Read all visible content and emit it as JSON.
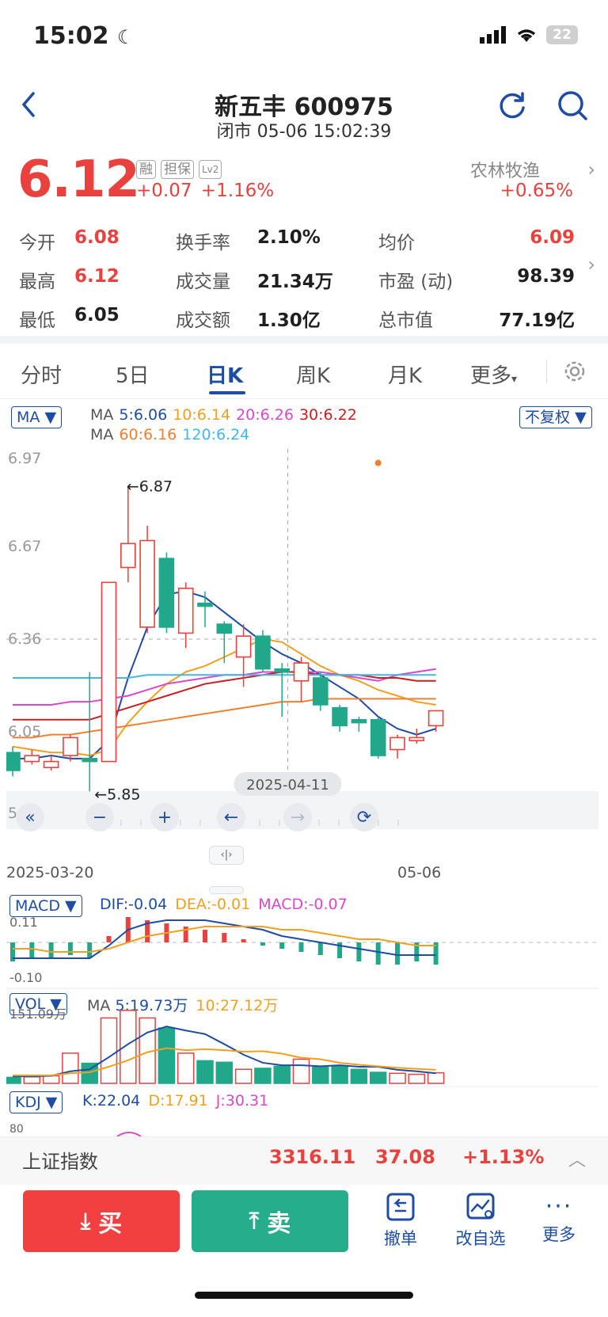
{
  "status_bar": {
    "time": "15:02",
    "battery": "22"
  },
  "header": {
    "title": "新五丰 600975",
    "subtitle": "闭市 05-06 15:02:39"
  },
  "quote": {
    "price": "6.12",
    "tags": [
      "融",
      "担保",
      "Lv2"
    ],
    "change": "+0.07",
    "change_pct": "+1.16%",
    "sector_name": "农林牧渔",
    "sector_change": "+0.65%"
  },
  "stats": [
    {
      "label": "今开",
      "value": "6.08",
      "color": "#e8413e"
    },
    {
      "label": "换手率",
      "value": "2.10%",
      "color": "#1f1f1f"
    },
    {
      "label": "均价",
      "value": "6.09",
      "color": "#e8413e"
    },
    {
      "label": "最高",
      "value": "6.12",
      "color": "#e8413e"
    },
    {
      "label": "成交量",
      "value": "21.34万",
      "color": "#1f1f1f"
    },
    {
      "label": "市盈 (动)",
      "value": "98.39",
      "color": "#1f1f1f"
    },
    {
      "label": "最低",
      "value": "6.05",
      "color": "#1f1f1f"
    },
    {
      "label": "成交额",
      "value": "1.30亿",
      "color": "#1f1f1f"
    },
    {
      "label": "总市值",
      "value": "77.19亿",
      "color": "#1f1f1f"
    }
  ],
  "tabs": [
    "分时",
    "5日",
    "日K",
    "周K",
    "月K",
    "更多"
  ],
  "ma_panel": {
    "indicator": "MA",
    "adjust": "不复权",
    "line1": [
      {
        "text": "MA",
        "color": "#555555"
      },
      {
        "text": "5:6.06",
        "color": "#1f4da3"
      },
      {
        "text": "10:6.14",
        "color": "#f0a020"
      },
      {
        "text": "20:6.26",
        "color": "#d848c8"
      },
      {
        "text": "30:6.22",
        "color": "#c82020"
      }
    ],
    "line2": [
      {
        "text": "MA",
        "color": "#555555"
      },
      {
        "text": "60:6.16",
        "color": "#f08030"
      },
      {
        "text": "120:6.24",
        "color": "#40b8e8"
      }
    ]
  },
  "chart_data": {
    "type": "candlestick",
    "y_ticks": [
      "6.97",
      "6.67",
      "6.36",
      "6.05",
      "5.75"
    ],
    "ylim": [
      5.75,
      6.97
    ],
    "x_labels": [
      "2025-03-20",
      "05-06"
    ],
    "crosshair_label": "2025-04-11",
    "high_annotation": "←6.87",
    "low_annotation": "←5.85",
    "candles": [
      {
        "o": 5.98,
        "c": 5.92,
        "h": 6.0,
        "l": 5.9
      },
      {
        "o": 5.95,
        "c": 5.97,
        "h": 5.99,
        "l": 5.94
      },
      {
        "o": 5.93,
        "c": 5.95,
        "h": 5.97,
        "l": 5.92
      },
      {
        "o": 5.97,
        "c": 6.03,
        "h": 6.04,
        "l": 5.95
      },
      {
        "o": 5.96,
        "c": 5.95,
        "h": 6.25,
        "l": 5.85
      },
      {
        "o": 5.95,
        "c": 6.55,
        "h": 6.55,
        "l": 5.95
      },
      {
        "o": 6.6,
        "c": 6.68,
        "h": 6.87,
        "l": 6.55
      },
      {
        "o": 6.4,
        "c": 6.69,
        "h": 6.74,
        "l": 6.38
      },
      {
        "o": 6.63,
        "c": 6.4,
        "h": 6.65,
        "l": 6.38
      },
      {
        "o": 6.38,
        "c": 6.53,
        "h": 6.55,
        "l": 6.33
      },
      {
        "o": 6.48,
        "c": 6.47,
        "h": 6.52,
        "l": 6.4
      },
      {
        "o": 6.41,
        "c": 6.38,
        "h": 6.42,
        "l": 6.28
      },
      {
        "o": 6.3,
        "c": 6.37,
        "h": 6.41,
        "l": 6.2
      },
      {
        "o": 6.37,
        "c": 6.26,
        "h": 6.39,
        "l": 6.25
      },
      {
        "o": 6.26,
        "c": 6.25,
        "h": 6.28,
        "l": 6.1
      },
      {
        "o": 6.22,
        "c": 6.28,
        "h": 6.3,
        "l": 6.15
      },
      {
        "o": 6.23,
        "c": 6.14,
        "h": 6.25,
        "l": 6.12
      },
      {
        "o": 6.13,
        "c": 6.07,
        "h": 6.14,
        "l": 6.05
      },
      {
        "o": 6.09,
        "c": 6.08,
        "h": 6.1,
        "l": 6.05
      },
      {
        "o": 6.09,
        "c": 5.97,
        "h": 6.1,
        "l": 5.96
      },
      {
        "o": 5.99,
        "c": 6.03,
        "h": 6.04,
        "l": 5.96
      },
      {
        "o": 6.02,
        "c": 6.03,
        "h": 6.06,
        "l": 6.01
      },
      {
        "o": 6.07,
        "c": 6.12,
        "h": 6.12,
        "l": 6.05
      }
    ],
    "ma_lines": [
      {
        "name": "MA5",
        "color": "#1f4da3",
        "values": [
          5.96,
          5.96,
          5.97,
          5.96,
          5.96,
          6.02,
          6.23,
          6.4,
          6.51,
          6.52,
          6.5,
          6.45,
          6.4,
          6.35,
          6.31,
          6.28,
          6.24,
          6.2,
          6.16,
          6.1,
          6.06,
          6.04,
          6.06
        ]
      },
      {
        "name": "MA10",
        "color": "#f0a020",
        "values": [
          6.0,
          5.99,
          5.98,
          5.98,
          5.97,
          5.99,
          6.08,
          6.15,
          6.21,
          6.25,
          6.27,
          6.3,
          6.33,
          6.36,
          6.35,
          6.31,
          6.27,
          6.24,
          6.22,
          6.19,
          6.17,
          6.15,
          6.14
        ]
      },
      {
        "name": "MA20",
        "color": "#d848c8",
        "values": [
          6.14,
          6.14,
          6.14,
          6.15,
          6.15,
          6.16,
          6.17,
          6.19,
          6.21,
          6.22,
          6.23,
          6.24,
          6.24,
          6.25,
          6.25,
          6.25,
          6.25,
          6.24,
          6.23,
          6.22,
          6.24,
          6.25,
          6.26
        ]
      },
      {
        "name": "MA30",
        "color": "#c82020",
        "values": [
          6.09,
          6.09,
          6.09,
          6.09,
          6.09,
          6.11,
          6.13,
          6.15,
          6.17,
          6.19,
          6.21,
          6.22,
          6.23,
          6.24,
          6.25,
          6.25,
          6.24,
          6.24,
          6.24,
          6.23,
          6.23,
          6.22,
          6.22
        ]
      },
      {
        "name": "MA60",
        "color": "#f08030",
        "values": [
          6.03,
          6.03,
          6.04,
          6.04,
          6.05,
          6.06,
          6.07,
          6.08,
          6.09,
          6.1,
          6.11,
          6.12,
          6.13,
          6.14,
          6.15,
          6.15,
          6.16,
          6.16,
          6.16,
          6.16,
          6.16,
          6.16,
          6.16
        ]
      },
      {
        "name": "MA120",
        "color": "#40b8e8",
        "values": [
          6.23,
          6.23,
          6.23,
          6.23,
          6.23,
          6.23,
          6.23,
          6.24,
          6.24,
          6.24,
          6.24,
          6.24,
          6.24,
          6.24,
          6.24,
          6.24,
          6.24,
          6.24,
          6.24,
          6.24,
          6.24,
          6.24,
          6.24
        ]
      }
    ]
  },
  "macd": {
    "label": "MACD",
    "dif": "DIF:-0.04",
    "dea": "DEA:-0.01",
    "macd": "MACD:-0.07",
    "top_tick": "0.11",
    "bottom_tick": "-0.10",
    "bars": [
      -0.06,
      -0.05,
      -0.05,
      -0.04,
      -0.05,
      0.02,
      0.08,
      0.07,
      0.06,
      0.05,
      0.04,
      0.03,
      0.01,
      -0.01,
      -0.02,
      -0.03,
      -0.04,
      -0.05,
      -0.06,
      -0.07,
      -0.07,
      -0.06,
      -0.07
    ],
    "dif_values": [
      -0.05,
      -0.05,
      -0.05,
      -0.05,
      -0.05,
      -0.01,
      0.04,
      0.06,
      0.07,
      0.07,
      0.07,
      0.06,
      0.05,
      0.04,
      0.02,
      0.01,
      0.0,
      -0.01,
      -0.02,
      -0.03,
      -0.04,
      -0.04,
      -0.04
    ],
    "dea_values": [
      -0.02,
      -0.02,
      -0.03,
      -0.03,
      -0.03,
      -0.02,
      0.0,
      0.02,
      0.03,
      0.04,
      0.05,
      0.05,
      0.05,
      0.05,
      0.04,
      0.04,
      0.03,
      0.02,
      0.01,
      0.01,
      0.0,
      -0.01,
      -0.01
    ]
  },
  "vol": {
    "label": "VOL",
    "ma_prefix": "MA",
    "ma5": "5:19.73万",
    "ma10": "10:27.12万",
    "top_tick": "151.09万",
    "bars": [
      12,
      13,
      15,
      60,
      40,
      130,
      145,
      130,
      110,
      60,
      45,
      42,
      28,
      30,
      34,
      48,
      32,
      34,
      28,
      22,
      20,
      18,
      21
    ],
    "ma5_values": [
      14,
      14,
      15,
      24,
      28,
      52,
      78,
      101,
      113,
      105,
      98,
      78,
      57,
      41,
      36,
      36,
      34,
      36,
      33,
      33,
      27,
      24,
      20
    ],
    "ma10_values": [
      16,
      16,
      16,
      20,
      22,
      33,
      46,
      62,
      70,
      66,
      68,
      66,
      63,
      64,
      59,
      51,
      48,
      41,
      37,
      34,
      31,
      29,
      27
    ]
  },
  "kdj": {
    "label": "KDJ",
    "k": "K:22.04",
    "d": "D:17.91",
    "j": "J:30.31",
    "tick": "80"
  },
  "index_bar": {
    "name": "上证指数",
    "value": "3316.11",
    "change": "37.08",
    "change_pct": "+1.13%"
  },
  "actions": {
    "buy": "买",
    "sell": "卖",
    "cancel": "撤单",
    "edit_watch": "改自选",
    "more": "更多"
  },
  "colors": {
    "up": "#e8413e",
    "down": "#21a88a",
    "accent": "#1f4da3"
  }
}
